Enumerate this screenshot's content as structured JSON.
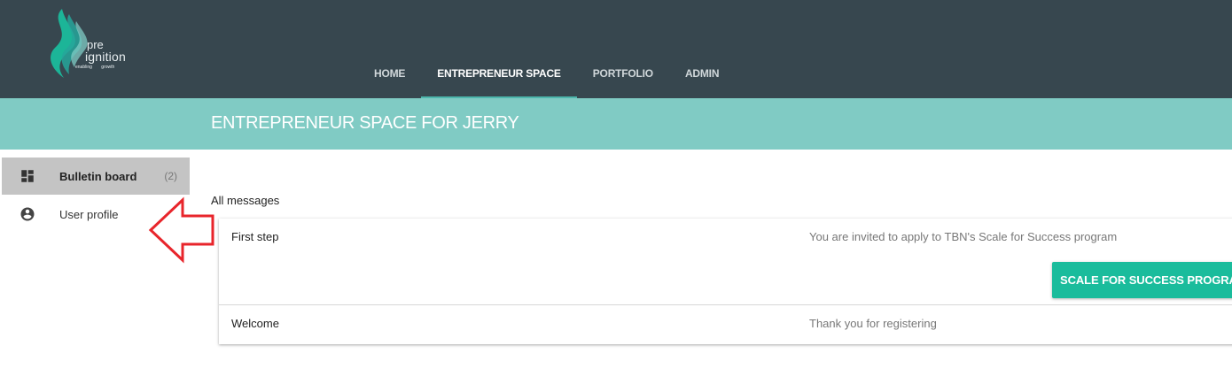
{
  "brand": {
    "name_top": "pre",
    "name_bottom": "ignition",
    "tagline": "enabling growth",
    "colors": {
      "primary": "#37474f",
      "accent": "#4db6ac",
      "banner": "#80cbc4",
      "button": "#1abc9c"
    }
  },
  "nav": {
    "tabs": [
      {
        "label": "HOME",
        "active": false
      },
      {
        "label": "ENTREPRENEUR SPACE",
        "active": true
      },
      {
        "label": "PORTFOLIO",
        "active": false
      },
      {
        "label": "ADMIN",
        "active": false
      }
    ]
  },
  "banner": {
    "title": "ENTREPRENEUR SPACE FOR JERRY"
  },
  "sidebar": {
    "items": [
      {
        "label": "Bulletin board",
        "count": "(2)",
        "icon": "dashboard-icon",
        "active": true
      },
      {
        "label": "User profile",
        "count": "",
        "icon": "account-circle-icon",
        "active": false
      }
    ]
  },
  "annotation": {
    "icon": "red-arrow-left-icon"
  },
  "messages": {
    "section_label": "All messages",
    "items": [
      {
        "title": "First step",
        "body": "You are invited to apply to TBN's Scale for Success program",
        "action_label": "SCALE FOR SUCCESS PROGRAM"
      },
      {
        "title": "Welcome",
        "body": "Thank you for registering"
      }
    ]
  }
}
